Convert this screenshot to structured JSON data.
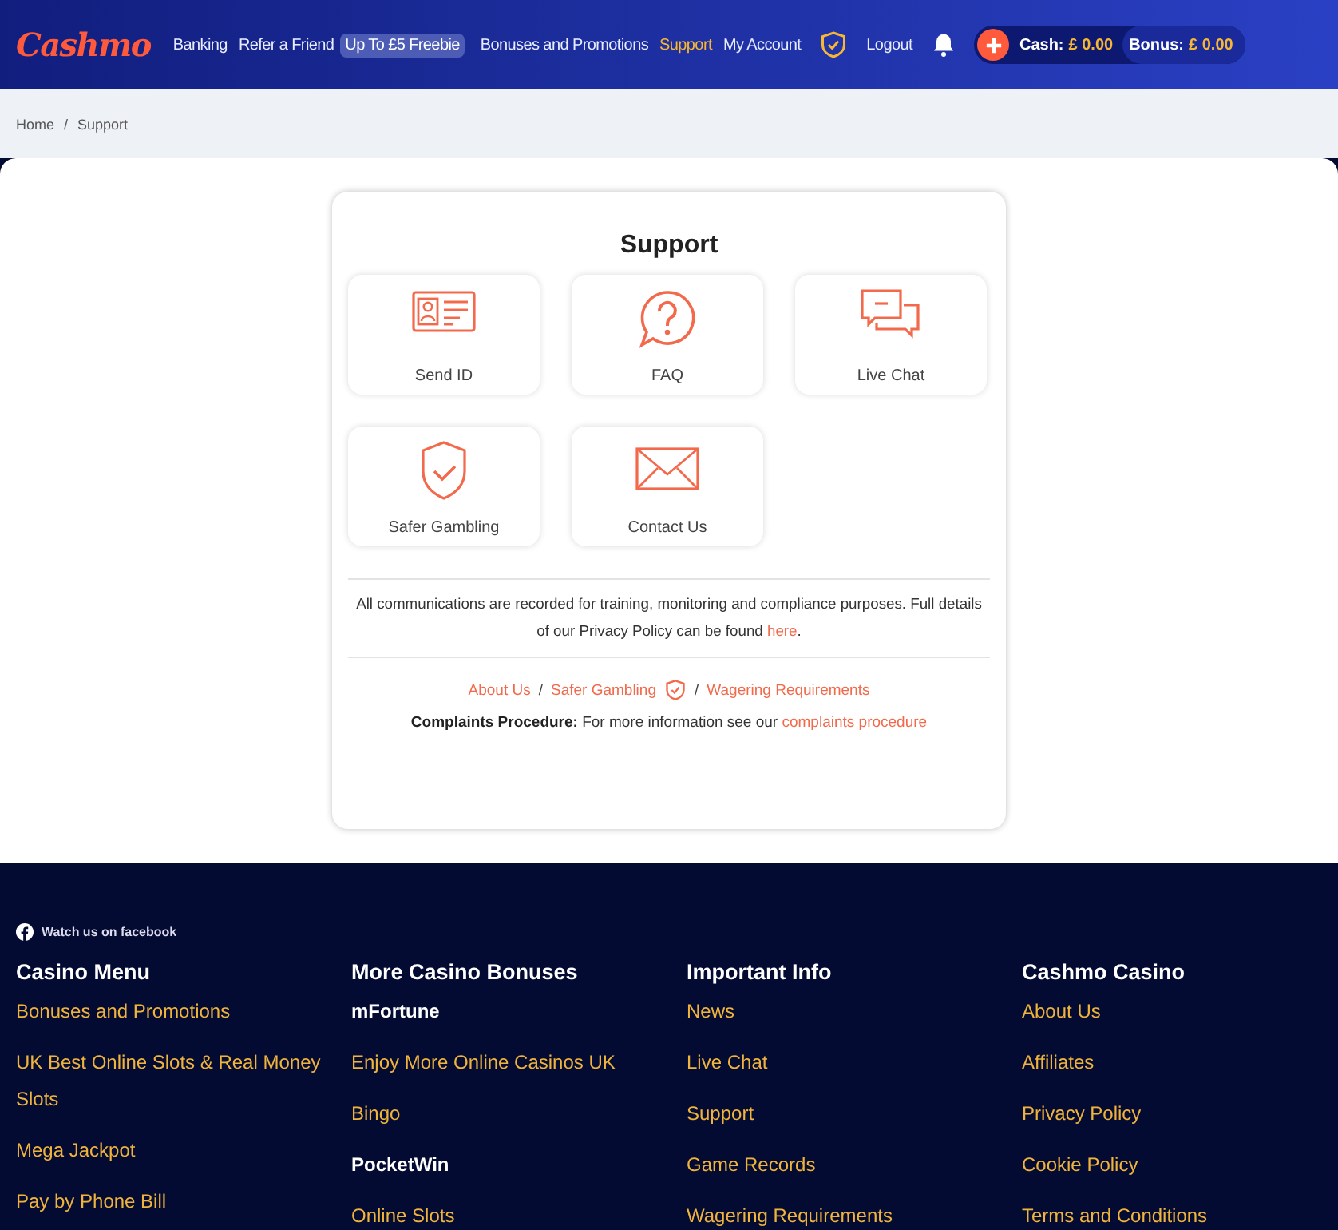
{
  "header": {
    "logo": "Cashmo",
    "nav": [
      {
        "label": "Banking",
        "selected": false
      },
      {
        "label": "Refer a Friend",
        "selected": false,
        "badge": "Up To £5 Freebie"
      },
      {
        "label": "Bonuses and Promotions",
        "selected": false
      },
      {
        "label": "Support",
        "selected": true
      },
      {
        "label": "My Account",
        "selected": false
      }
    ],
    "logout": "Logout",
    "cash_label": "Cash:",
    "cash": "£ 0.00",
    "bonus_label": "Bonus:",
    "bonus": "£ 0.00"
  },
  "breadcrumb": {
    "items": [
      "Home",
      "Support"
    ],
    "separator": "/"
  },
  "support": {
    "title": "Support",
    "tiles": [
      {
        "label": "Send ID",
        "kind": "id"
      },
      {
        "label": "FAQ",
        "kind": "faq"
      },
      {
        "label": "Live Chat",
        "kind": "chat"
      },
      {
        "label": "Safer Gambling",
        "kind": "shield"
      },
      {
        "label": "Contact Us",
        "kind": "mail"
      }
    ],
    "notice": "All communications are recorded for training, monitoring and compliance purposes. Full details of our Privacy Policy can be found ",
    "notice_link": "here",
    "notice_end": ".",
    "links": [
      "About Us",
      "Safer Gambling",
      "Wagering Requirements"
    ],
    "link_separator": "/",
    "complaints_label": "Complaints Procedure:",
    "complaints_text": "For more information see our",
    "complaints_link": "complaints procedure"
  },
  "footer": {
    "facebook": "Watch us on facebook",
    "columns": [
      {
        "title": "Casino Menu",
        "items": [
          {
            "label": "Bonuses and Promotions",
            "kind": "link"
          },
          {
            "label": "UK Best Online Slots & Real Money Slots",
            "kind": "link"
          },
          {
            "label": "Mega Jackpot",
            "kind": "link"
          },
          {
            "label": "Pay by Phone Bill",
            "kind": "link"
          }
        ]
      },
      {
        "title": "More Casino Bonuses",
        "items": [
          {
            "label": "mFortune",
            "kind": "brand"
          },
          {
            "label": "Enjoy More Online Casinos UK",
            "kind": "link"
          },
          {
            "label": "Bingo",
            "kind": "link"
          },
          {
            "label": "PocketWin",
            "kind": "brand"
          },
          {
            "label": "Online Slots",
            "kind": "link"
          }
        ]
      },
      {
        "title": "Important Info",
        "items": [
          {
            "label": "News",
            "kind": "link"
          },
          {
            "label": "Live Chat",
            "kind": "link"
          },
          {
            "label": "Support",
            "kind": "link"
          },
          {
            "label": "Game Records",
            "kind": "link"
          },
          {
            "label": "Wagering Requirements",
            "kind": "link"
          }
        ]
      },
      {
        "title": "Cashmo Casino",
        "items": [
          {
            "label": "About Us",
            "kind": "link"
          },
          {
            "label": "Affiliates",
            "kind": "link"
          },
          {
            "label": "Privacy Policy",
            "kind": "link"
          },
          {
            "label": "Cookie Policy",
            "kind": "link"
          },
          {
            "label": "Terms and Conditions",
            "kind": "link"
          }
        ]
      }
    ]
  }
}
